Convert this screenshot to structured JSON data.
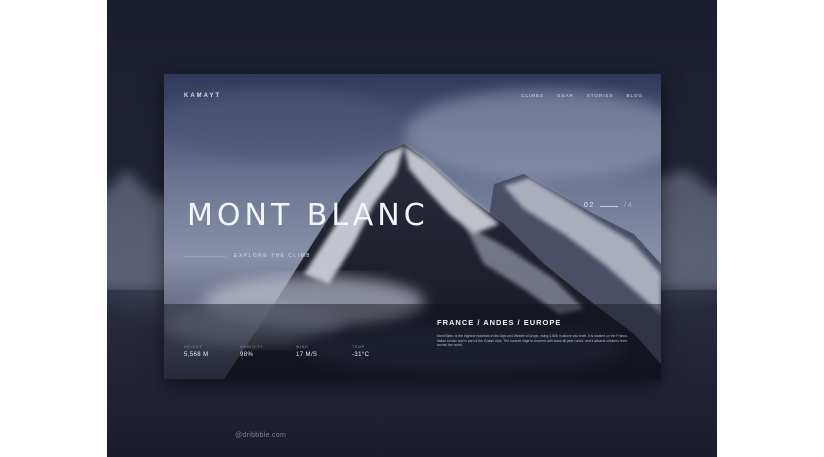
{
  "footer": {
    "handle": "@dribbble.com"
  },
  "hero": {
    "logo": "KAMAYT",
    "nav": [
      "CLIMBS",
      "GEAR",
      "STORIES",
      "BLOG"
    ],
    "title": "MONT BLANC",
    "subtitle": "EXPLORE THE CLIMB",
    "slide": {
      "current": "02",
      "total": "/ 4"
    },
    "stats": [
      {
        "label": "HEIGHT",
        "value": "5,568 M"
      },
      {
        "label": "HUMIDITY",
        "value": "98%"
      },
      {
        "label": "WIND",
        "value": "17 M/S"
      },
      {
        "label": "TEMP",
        "value": "-31°C"
      }
    ],
    "location": "FRANCE / ANDES / EUROPE",
    "description": "Mont Blanc is the highest mountain in the Alps and Western Europe, rising 4,808 m above sea level. It is located on the Franco-Italian border and is part of the Graian Alps. The summit ridge is covered with snow all year round, and it attracts climbers from across the world."
  },
  "colors": {
    "backdrop": "#1f2233",
    "card_shadow": "#1c1f30",
    "text": "#f4f5f8"
  }
}
